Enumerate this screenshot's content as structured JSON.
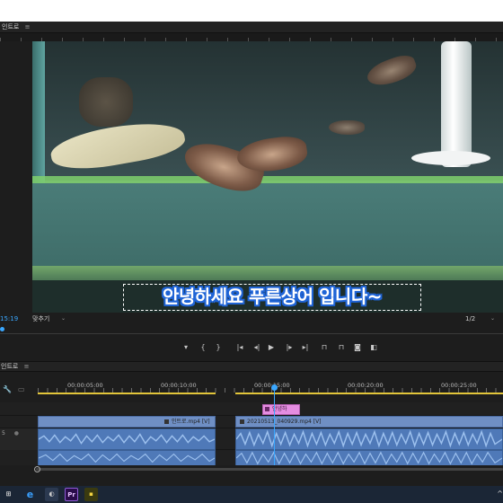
{
  "program_monitor": {
    "tab_label": "인트로",
    "menu_glyph": "≡",
    "timecode": "15:19",
    "fit_label": "맞추기",
    "fit_caret": "⌄",
    "resolution": "1/2",
    "resolution_caret": "⌄"
  },
  "subtitle": {
    "text": "안녕하세요 푸른상어 입니다~",
    "outline_color": "#1f64d6"
  },
  "transport": {
    "buttons": [
      {
        "name": "add-marker-button",
        "glyph": "▾",
        "icon": "marker-icon"
      },
      {
        "name": "mark-in-button",
        "glyph": "{",
        "icon": "mark-in-icon"
      },
      {
        "name": "mark-out-button",
        "glyph": "}",
        "icon": "mark-out-icon"
      },
      {
        "name": "go-to-in-button",
        "glyph": "|◂",
        "icon": "go-to-in-icon"
      },
      {
        "name": "step-back-button",
        "glyph": "◂|",
        "icon": "step-back-icon"
      },
      {
        "name": "play-button",
        "glyph": "▶",
        "icon": "play-icon"
      },
      {
        "name": "step-forward-button",
        "glyph": "|▸",
        "icon": "step-forward-icon"
      },
      {
        "name": "go-to-out-button",
        "glyph": "▸|",
        "icon": "go-to-out-icon"
      },
      {
        "name": "lift-button",
        "glyph": "⊓",
        "icon": "lift-icon"
      },
      {
        "name": "extract-button",
        "glyph": "⊓",
        "icon": "extract-icon"
      },
      {
        "name": "export-frame-button",
        "glyph": "◙",
        "icon": "camera-icon"
      },
      {
        "name": "comparison-view-button",
        "glyph": "◧",
        "icon": "comparison-icon"
      }
    ]
  },
  "timeline": {
    "tab_label": "인트로",
    "menu_glyph": "≡",
    "ruler_labels": [
      "00:00:05:00",
      "00:00:10:00",
      "00:00:15:00",
      "00:00:20:00",
      "00:00:25:00"
    ],
    "track_labels": {
      "v": "",
      "a1": "5",
      "a2": ""
    },
    "graphic_clip_label": "안녕하",
    "video_clips": [
      {
        "label": "인트로.mp4 [V]"
      },
      {
        "label": "20210513_040929.mp4 [V]"
      }
    ]
  },
  "taskbar": {
    "icons": [
      {
        "name": "start-icon",
        "glyph": "⊞"
      },
      {
        "name": "ie-icon",
        "glyph": "e"
      },
      {
        "name": "explorer-icon",
        "glyph": "◐"
      },
      {
        "name": "premiere-icon",
        "glyph": "Pr"
      },
      {
        "name": "sticky-notes-icon",
        "glyph": "▪"
      }
    ],
    "tray_glyph": "^"
  },
  "colors": {
    "accent_blue": "#3aa7ff",
    "clip_video": "#6f8fc4",
    "clip_audio": "#4f79b8",
    "clip_graphic": "#e58de1",
    "work_area": "#e2c53a"
  }
}
